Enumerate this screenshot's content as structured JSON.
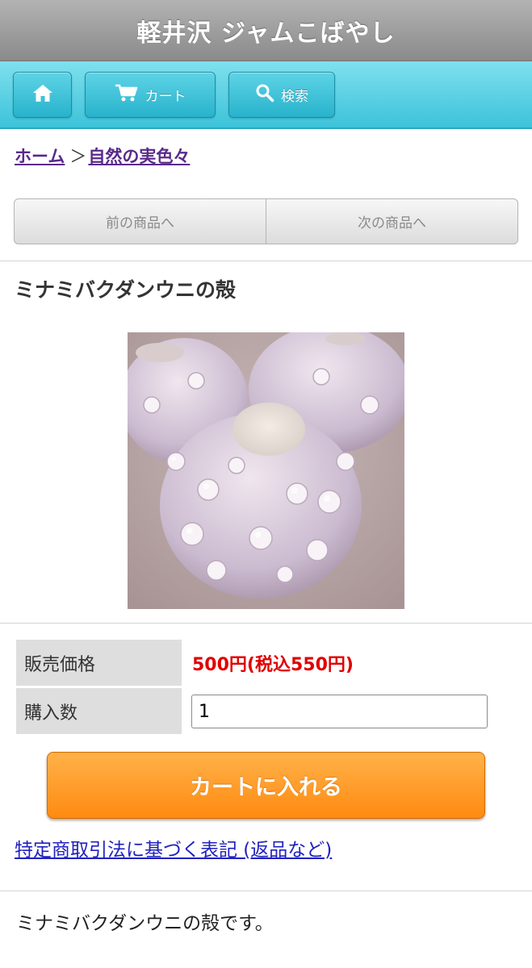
{
  "header": {
    "title": "軽井沢 ジャムこばやし"
  },
  "nav": {
    "home_icon": "home-icon",
    "cart_label": "カート",
    "cart_icon": "cart-icon",
    "search_label": "検索",
    "search_icon": "search-icon",
    "bar_color": "#3cc3da"
  },
  "breadcrumb": {
    "home": "ホーム",
    "separator": "＞",
    "category": "自然の実色々"
  },
  "pager": {
    "prev": "前の商品へ",
    "next": "次の商品へ"
  },
  "product": {
    "title": "ミナミバクダンウニの殻",
    "image_subject": "sea urchin shells",
    "price_label": "販売価格",
    "price_value": "500円(税込550円)",
    "price_color": "#e00000",
    "qty_label": "購入数",
    "qty_value": "1",
    "add_to_cart": "カートに入れる",
    "button_color": "#ff8a10",
    "legal_link": "特定商取引法に基づく表記 (返品など)",
    "description": "ミナミバクダンウニの殻です。"
  }
}
